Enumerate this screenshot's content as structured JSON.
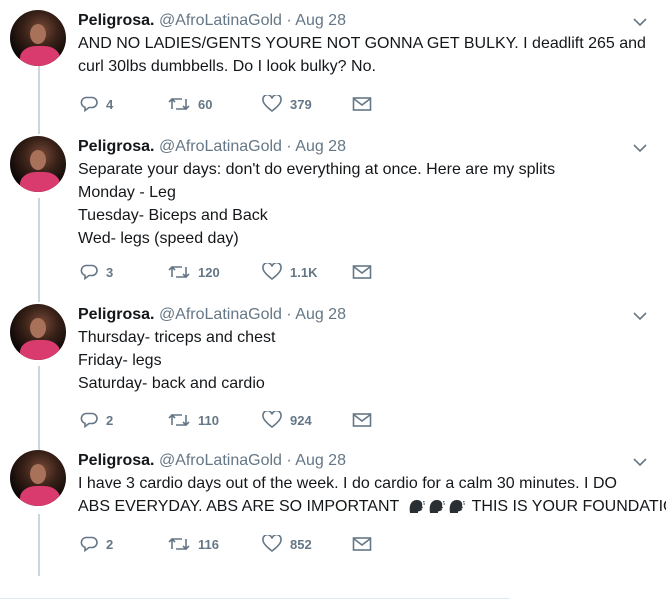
{
  "tweets": [
    {
      "name": "Peligrosa.",
      "handle": "@AfroLatinaGold",
      "sep": "·",
      "date": "Aug 28",
      "lines": [
        "AND NO LADIES/GENTS YOURE NOT GONNA GET BULKY. I deadlift 265 and",
        "curl 30lbs dumbbells. Do I look bulky? No."
      ],
      "replies": "4",
      "retweets": "60",
      "likes": "379"
    },
    {
      "name": "Peligrosa.",
      "handle": "@AfroLatinaGold",
      "sep": "·",
      "date": "Aug 28",
      "lines": [
        "Separate your days: don't do everything at once. Here are my splits",
        "Monday - Leg",
        "Tuesday- Biceps and Back",
        "Wed- legs (speed day)"
      ],
      "replies": "3",
      "retweets": "120",
      "likes": "1.1K"
    },
    {
      "name": "Peligrosa.",
      "handle": "@AfroLatinaGold",
      "sep": "·",
      "date": "Aug 28",
      "lines": [
        "Thursday- triceps and chest",
        "Friday- legs",
        "Saturday- back and cardio"
      ],
      "replies": "2",
      "retweets": "110",
      "likes": "924"
    },
    {
      "name": "Peligrosa.",
      "handle": "@AfroLatinaGold",
      "sep": "·",
      "date": "Aug 28",
      "lines": [
        "I have 3 cardio days out of the week. I do cardio for a calm 30 minutes. I DO",
        "ABS EVERYDAY. ABS ARE SO IMPORTANT",
        "THIS IS YOUR FOUNDATION"
      ],
      "replies": "2",
      "retweets": "116",
      "likes": "852"
    }
  ],
  "icons": {
    "reply": "reply-icon",
    "retweet": "retweet-icon",
    "like": "heart-icon",
    "dm": "envelope-icon",
    "menu": "chevron-down-icon",
    "emoji": "speaking-head-emoji"
  },
  "colors": {
    "text": "#14171a",
    "muted": "#657786",
    "thread_line": "#ccd6dd"
  }
}
